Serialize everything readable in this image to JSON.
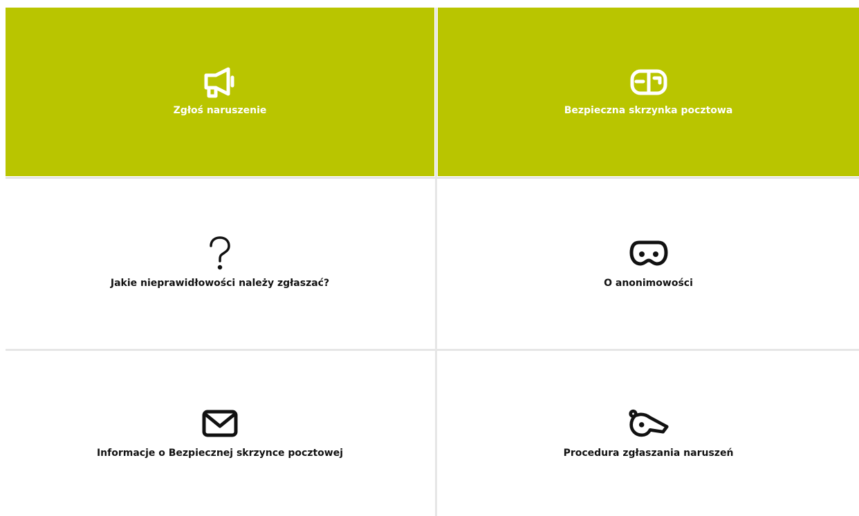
{
  "colors": {
    "accent": "#b9c500",
    "divider": "#e6e6e6",
    "text_dark": "#111111",
    "text_light": "#ffffff"
  },
  "tiles": [
    {
      "label": "Zgłoś naruszenie",
      "icon": "megaphone-icon"
    },
    {
      "label": "Bezpieczna skrzynka pocztowa",
      "icon": "mailbox-icon"
    },
    {
      "label": "Jakie nieprawidłowości należy zgłaszać?",
      "icon": "question-mark-icon"
    },
    {
      "label": "O anonimowości",
      "icon": "mask-icon"
    },
    {
      "label": "Informacje o Bezpiecznej skrzynce pocztowej",
      "icon": "envelope-icon"
    },
    {
      "label": "Procedura zgłaszania naruszeń",
      "icon": "whistle-icon"
    }
  ]
}
